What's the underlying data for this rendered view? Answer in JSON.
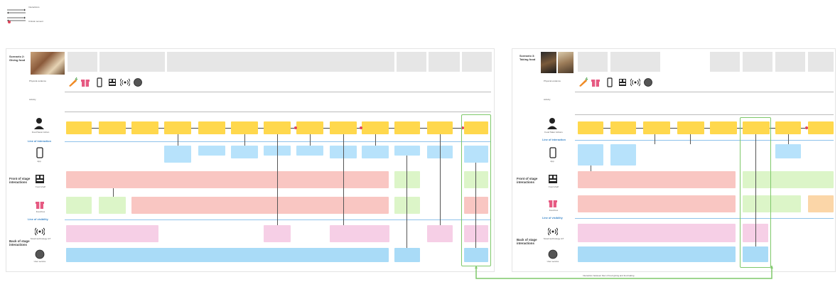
{
  "legend": {
    "items": [
      {
        "label": "Interactions"
      },
      {
        "label": "Critical moment"
      }
    ]
  },
  "colors": {
    "frontstage": "#ffd84d",
    "app": "#b7e2fb",
    "foodshelf": "#f9c6c2",
    "foodbox": "#dcf5c8",
    "tech": "#f6cfe6",
    "user_service": "#a9dbf7",
    "highlight": "#7ec86a"
  },
  "left": {
    "scenario": "Scenario 2: Giving food",
    "rows": {
      "physical": "Physical evidence",
      "activity": "Activity",
      "user": "Food Saver Action",
      "app": "App",
      "front_stage": "Front of stage interactions",
      "food_shelf": "Food shelf",
      "food_box": "Food box",
      "line_interaction": "Line of interaction",
      "line_visibility": "Line of visibility",
      "back_stage": "Back of stage interactions",
      "smart_tech": "Smart technology IoT",
      "user_service": "User service"
    },
    "icons": [
      "Food shelf",
      "Food box",
      "App",
      "Smart technology IoT",
      "User service"
    ]
  },
  "right": {
    "scenario": "Scenario 3: Taking food",
    "rows": {
      "physical": "Physical evidence",
      "activity": "Activity",
      "user": "Food Taker Actions",
      "app": "App",
      "front_stage": "Front of stage interactions",
      "food_shelf": "Food shelf",
      "food_box": "Food box",
      "line_interaction": "Line of interaction",
      "line_visibility": "Line of visibility",
      "back_stage": "Back of stage interactions",
      "smart_tech": "Smart technology IoT",
      "user_service": "User service"
    }
  },
  "footer_note": "Interaction between flow of food giving and food taking"
}
